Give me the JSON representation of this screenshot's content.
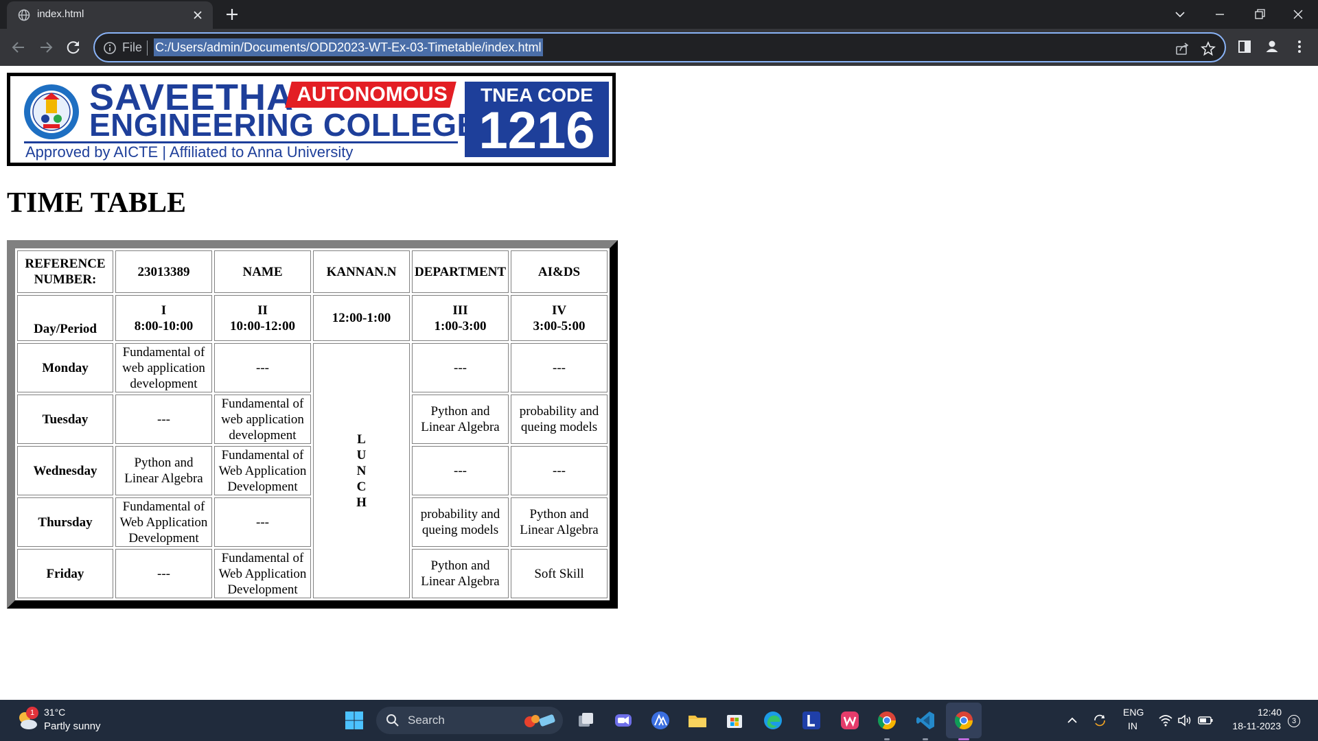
{
  "browser": {
    "tab_title": "index.html",
    "scheme_label": "File",
    "url": "C:/Users/admin/Documents/ODD2023-WT-Ex-03-Timetable/index.html"
  },
  "banner": {
    "college_name_line1": "SAVEETHA",
    "autonomous_badge": "AUTONOMOUS",
    "college_name_line2": "ENGINEERING COLLEGE",
    "tagline": "Approved by AICTE  |  Affiliated to Anna University",
    "tnea_label": "TNEA CODE",
    "tnea_code": "1216",
    "colors": {
      "brand_blue": "#1e3f9a",
      "badge_red": "#e31e24"
    }
  },
  "page": {
    "title": "TIME TABLE"
  },
  "timetable": {
    "info_row": [
      "REFERENCE NUMBER:",
      "23013389",
      "NAME",
      "KANNAN.N",
      "DEPARTMENT",
      "AI&DS"
    ],
    "header_row": {
      "day_period": "Day/Period",
      "p1_label": "I",
      "p1_time": "8:00-10:00",
      "p2_label": "II",
      "p2_time": "10:00-12:00",
      "lunch_time": "12:00-1:00",
      "p3_label": "III",
      "p3_time": "1:00-3:00",
      "p4_label": "IV",
      "p4_time": "3:00-5:00"
    },
    "lunch_letters": [
      "L",
      "U",
      "N",
      "C",
      "H"
    ],
    "rows": [
      {
        "day": "Monday",
        "p1": "Fundamental of web application development",
        "p2": "---",
        "p3": "---",
        "p4": "---"
      },
      {
        "day": "Tuesday",
        "p1": "---",
        "p2": "Fundamental of web application development",
        "p3": "Python and Linear Algebra",
        "p4": "probability and queing models"
      },
      {
        "day": "Wednesday",
        "p1": "Python and Linear Algebra",
        "p2": "Fundamental of Web Application Development",
        "p3": "---",
        "p4": "---"
      },
      {
        "day": "Thursday",
        "p1": "Fundamental of Web Application Development",
        "p2": "---",
        "p3": "probability and queing models",
        "p4": "Python and Linear Algebra"
      },
      {
        "day": "Friday",
        "p1": "---",
        "p2": "Fundamental of Web Application Development",
        "p3": "Python and Linear Algebra",
        "p4": "Soft Skill"
      }
    ]
  },
  "taskbar": {
    "weather_badge": "1",
    "temperature": "31°C",
    "condition": "Partly sunny",
    "search_placeholder": "Search",
    "lang_line1": "ENG",
    "lang_line2": "IN",
    "time": "12:40",
    "date": "18-11-2023",
    "notifications": "3"
  }
}
